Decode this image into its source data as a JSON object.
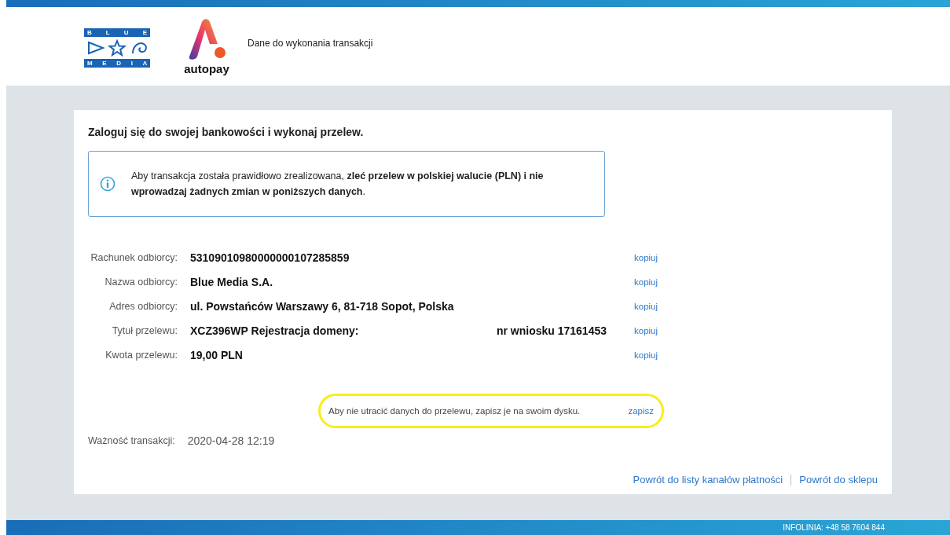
{
  "header": {
    "logo_top": [
      "B",
      "L",
      "U",
      "E"
    ],
    "logo_bottom": [
      "M",
      "E",
      "D",
      "I",
      "Λ"
    ],
    "brand": "autopay",
    "title": "Dane do wykonania transakcji"
  },
  "card": {
    "heading": "Zaloguj się do swojej bankowości i wykonaj przelew.",
    "info": "Aby transakcja została prawidłowo zrealizowana, **zleć przelew w polskiej walucie (PLN) i nie wprowadzaj żadnych zmian w poniższych danych**.",
    "fields": [
      {
        "label": "Rachunek odbiorcy:",
        "value_parts": [
          "53109010980000000107285859"
        ],
        "action": "kopiuj"
      },
      {
        "label": "Nazwa odbiorcy:",
        "value_parts": [
          "Blue Media S.A."
        ],
        "action": "kopiuj"
      },
      {
        "label": "Adres odbiorcy:",
        "value_parts": [
          "ul. Powstańców Warszawy 6, 81-718 Sopot, Polska"
        ],
        "action": "kopiuj"
      },
      {
        "label": "Tytuł przelewu:",
        "value_parts": [
          "XCZ396WP Rejestracja domeny:",
          "nr wniosku 17161453"
        ],
        "action": "kopiuj"
      },
      {
        "label": "Kwota przelewu:",
        "value_parts": [
          "19,00 PLN"
        ],
        "action": "kopiuj"
      }
    ],
    "save_note": {
      "text": "Aby nie utracić danych do przelewu, zapisz je na swoim dysku.",
      "action": "zapisz",
      "highlighted": true
    },
    "validity": {
      "label": "Ważność transakcji:",
      "value": "2020-04-28 12:19"
    },
    "links": [
      "Powrót do listy kanałów płatności",
      "Powrót do sklepu"
    ]
  },
  "footer": {
    "text": "INFOLINIA: +48 58 7604 844"
  }
}
